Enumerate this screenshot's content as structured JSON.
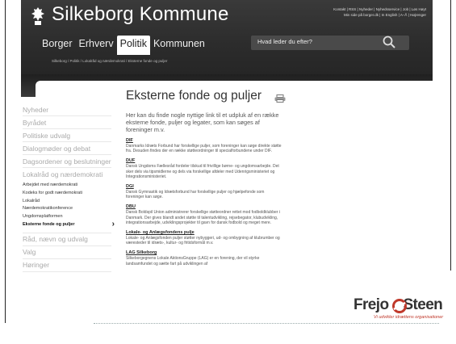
{
  "site": {
    "title": "Silkeborg Kommune",
    "util_links": [
      "Kontakt | RSS | Nyheder | Nyhedsservice | Job | Løs Høyt",
      "Min side på borger.dk | In English | A–Å | Højrenger"
    ],
    "nav": [
      "Borger",
      "Erhverv",
      "Politik",
      "Kommunen"
    ],
    "nav_active": "Politik",
    "search_placeholder": "Hvad leder du efter?",
    "breadcrumb": "Silkeborg / Politik / Lokalråd og nærdemokrati / Eksterne fonde og puljer"
  },
  "sidebar": {
    "items_top": [
      "Nyheder",
      "Byrådet",
      "Politiske udvalg",
      "Dialogmøder og debat",
      "Dagsordener og beslutninger",
      "Lokalråd og nærdemokrati"
    ],
    "subitems": [
      "Arbejdet med nærdemokrati",
      "Kodeks for godt nærdemokrati",
      "Lokalråd",
      "Nærdemokratikonference",
      "Ungdomsplatformen",
      "Eksterne fonde og puljer"
    ],
    "items_bottom": [
      "Råd, nævn og udvalg",
      "Valg",
      "Høringer"
    ]
  },
  "content": {
    "title": "Eksterne fonde og puljer",
    "intro": "Her kan du finde nogle nyttige link til et udpluk af en række eksterne fonde, puljer og legater, som kan søges af foreninger m.v.",
    "entries": [
      {
        "title": "DIF",
        "text": "Danmarks Idræts Forbund har forskellige puljer, som foreninger kan søge direkte støtte fra. Desuden findes der en række støtteordninger til specialforbundene under DIF."
      },
      {
        "title": "DUF",
        "text": "Dansk Ungdoms Fællesråd fordeler tilskud til frivillige børne- og ungdomsarbejde. Det sker dels via tipsmidlerne og dels via forskellige afdeler med Udenrigsministeriet og Integrationsministeriet."
      },
      {
        "title": "DGI",
        "text": "Dansk Gymnastik og Idrætsforbund har forskellige puljer og hjælpefonde som foreninger kan søge."
      },
      {
        "title": "DBU",
        "text": "Dansk Boldspil Union administrerer forskellige støtteordner rettet mod fodboldklubber i Danmark. Der gives blandt andet støtte til talentudvikling, rejsebegator, klubudvikling, integrationsarbejde, udviklingsprojekter til gavn for dansk fodbold og meget mere."
      },
      {
        "title": "Lokale- og Anlægsfondens pulje",
        "text": "Lokale- og Anlægsfonden puljer støtter nybyggeri, ud- og ombygning af klubrum­ber og væresteder til idræts-, kultur- og fritidsformål m.v."
      },
      {
        "title": "LAG Silkeborg",
        "text": "Silkeborgegnens Lokale AktionsGruppe (LAG) er en forening, der vil styrke landsamfundet og sætte fart på udviklingen af"
      }
    ]
  },
  "footer": {
    "brand": "Frejo",
    "brand_rest": "Steen",
    "tagline": "Vi udvikler idrættens organisationer"
  },
  "colors": {
    "header": "#2e2e2e",
    "tagline": "#c0392b"
  }
}
